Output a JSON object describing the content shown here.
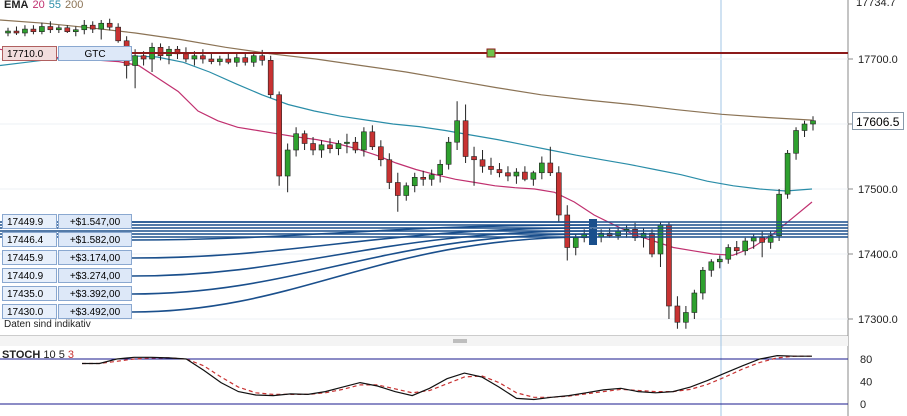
{
  "ema_legend": {
    "label": "EMA",
    "p1": "20",
    "p2": "55",
    "p3": "200",
    "c1": "#c0306f",
    "c2": "#2a8da8",
    "c3": "#8b7355"
  },
  "axis": {
    "price_ticks": [
      {
        "v": 17700,
        "label": "17700.0"
      },
      {
        "v": 17600,
        "label": "17600.0"
      },
      {
        "v": 17500,
        "label": "17500.0"
      },
      {
        "v": 17400,
        "label": "17400.0"
      },
      {
        "v": 17300,
        "label": "17300.0"
      }
    ],
    "top_tick": "17734.7",
    "stoch_ticks": [
      "80",
      "40",
      "0"
    ]
  },
  "current_price": "17606.5",
  "gtc_order": {
    "price": "17710.0",
    "label": "GTC"
  },
  "orders": [
    {
      "price": "17449.9",
      "pnl": "+$1.547,00"
    },
    {
      "price": "17446.4",
      "pnl": "+$1.582,00"
    },
    {
      "price": "17445.9",
      "pnl": "+$3.174,00"
    },
    {
      "price": "17440.9",
      "pnl": "+$3.274,00"
    },
    {
      "price": "17435.0",
      "pnl": "+$3.392,00"
    },
    {
      "price": "17430.0",
      "pnl": "+$3.492,00"
    }
  ],
  "info_text": "Daten sind indikativ",
  "stoch_legend": {
    "label": "STOCH",
    "p1": "10",
    "p2": "5",
    "p3": "3"
  },
  "colors": {
    "up": "#2ea02e",
    "down": "#c83232",
    "order_line": "#1a4f8c",
    "gtc_line": "#8b1a1a",
    "ema20": "#c0306f",
    "ema55": "#2a8da8",
    "ema200": "#8b7355"
  },
  "chart_data": {
    "type": "candlestick",
    "candles": [
      [
        17740,
        17748,
        17735,
        17743
      ],
      [
        17743,
        17750,
        17737,
        17740
      ],
      [
        17740,
        17752,
        17735,
        17746
      ],
      [
        17746,
        17752,
        17738,
        17742
      ],
      [
        17742,
        17756,
        17738,
        17750
      ],
      [
        17750,
        17758,
        17740,
        17745
      ],
      [
        17745,
        17752,
        17740,
        17748
      ],
      [
        17748,
        17752,
        17740,
        17742
      ],
      [
        17742,
        17750,
        17735,
        17745
      ],
      [
        17745,
        17760,
        17738,
        17752
      ],
      [
        17752,
        17758,
        17740,
        17746
      ],
      [
        17746,
        17760,
        17730,
        17755
      ],
      [
        17755,
        17762,
        17744,
        17749
      ],
      [
        17749,
        17755,
        17725,
        17728
      ],
      [
        17728,
        17735,
        17670,
        17690
      ],
      [
        17690,
        17715,
        17655,
        17705
      ],
      [
        17705,
        17712,
        17690,
        17700
      ],
      [
        17700,
        17725,
        17680,
        17718
      ],
      [
        17718,
        17724,
        17698,
        17705
      ],
      [
        17705,
        17720,
        17692,
        17715
      ],
      [
        17715,
        17720,
        17700,
        17708
      ],
      [
        17708,
        17718,
        17695,
        17700
      ],
      [
        17700,
        17712,
        17690,
        17705
      ],
      [
        17705,
        17715,
        17693,
        17700
      ],
      [
        17700,
        17708,
        17692,
        17696
      ],
      [
        17696,
        17705,
        17690,
        17700
      ],
      [
        17700,
        17708,
        17692,
        17695
      ],
      [
        17695,
        17710,
        17688,
        17702
      ],
      [
        17702,
        17710,
        17690,
        17695
      ],
      [
        17695,
        17710,
        17688,
        17705
      ],
      [
        17705,
        17714,
        17690,
        17698
      ],
      [
        17698,
        17705,
        17640,
        17645
      ],
      [
        17645,
        17650,
        17505,
        17520
      ],
      [
        17520,
        17570,
        17495,
        17560
      ],
      [
        17560,
        17595,
        17550,
        17585
      ],
      [
        17585,
        17590,
        17560,
        17570
      ],
      [
        17570,
        17580,
        17552,
        17560
      ],
      [
        17560,
        17575,
        17548,
        17568
      ],
      [
        17568,
        17578,
        17555,
        17562
      ],
      [
        17562,
        17575,
        17552,
        17570
      ],
      [
        17570,
        17585,
        17555,
        17572
      ],
      [
        17572,
        17580,
        17555,
        17560
      ],
      [
        17560,
        17595,
        17550,
        17588
      ],
      [
        17588,
        17598,
        17560,
        17565
      ],
      [
        17565,
        17575,
        17535,
        17545
      ],
      [
        17545,
        17555,
        17500,
        17510
      ],
      [
        17510,
        17525,
        17465,
        17490
      ],
      [
        17490,
        17510,
        17482,
        17505
      ],
      [
        17505,
        17525,
        17495,
        17518
      ],
      [
        17518,
        17528,
        17505,
        17515
      ],
      [
        17515,
        17530,
        17505,
        17522
      ],
      [
        17522,
        17545,
        17510,
        17538
      ],
      [
        17538,
        17580,
        17530,
        17572
      ],
      [
        17572,
        17635,
        17560,
        17605
      ],
      [
        17605,
        17630,
        17540,
        17550
      ],
      [
        17550,
        17565,
        17505,
        17545
      ],
      [
        17545,
        17560,
        17525,
        17535
      ],
      [
        17535,
        17548,
        17522,
        17530
      ],
      [
        17530,
        17540,
        17518,
        17525
      ],
      [
        17525,
        17535,
        17512,
        17520
      ],
      [
        17520,
        17532,
        17508,
        17526
      ],
      [
        17526,
        17535,
        17512,
        17515
      ],
      [
        17515,
        17528,
        17505,
        17525
      ],
      [
        17525,
        17550,
        17515,
        17540
      ],
      [
        17540,
        17565,
        17520,
        17525
      ],
      [
        17525,
        17535,
        17450,
        17460
      ],
      [
        17460,
        17475,
        17390,
        17410
      ],
      [
        17410,
        17430,
        17398,
        17425
      ],
      [
        17425,
        17438,
        17418,
        17430
      ],
      [
        17430,
        17440,
        17420,
        17426
      ],
      [
        17426,
        17438,
        17418,
        17432
      ],
      [
        17432,
        17440,
        17425,
        17428
      ],
      [
        17428,
        17440,
        17422,
        17435
      ],
      [
        17435,
        17445,
        17425,
        17438
      ],
      [
        17438,
        17448,
        17420,
        17425
      ],
      [
        17425,
        17440,
        17410,
        17432
      ],
      [
        17432,
        17438,
        17395,
        17400
      ],
      [
        17400,
        17450,
        17380,
        17445
      ],
      [
        17445,
        17450,
        17300,
        17320
      ],
      [
        17320,
        17335,
        17285,
        17295
      ],
      [
        17295,
        17320,
        17285,
        17310
      ],
      [
        17310,
        17345,
        17300,
        17340
      ],
      [
        17340,
        17380,
        17330,
        17375
      ],
      [
        17375,
        17392,
        17365,
        17388
      ],
      [
        17388,
        17398,
        17378,
        17392
      ],
      [
        17392,
        17415,
        17385,
        17410
      ],
      [
        17410,
        17420,
        17398,
        17405
      ],
      [
        17405,
        17425,
        17398,
        17420
      ],
      [
        17420,
        17430,
        17408,
        17425
      ],
      [
        17425,
        17435,
        17395,
        17418
      ],
      [
        17418,
        17435,
        17408,
        17428
      ],
      [
        17428,
        17500,
        17420,
        17492
      ],
      [
        17492,
        17560,
        17485,
        17555
      ],
      [
        17555,
        17595,
        17545,
        17590
      ],
      [
        17590,
        17605,
        17580,
        17600
      ],
      [
        17600,
        17612,
        17590,
        17605
      ]
    ],
    "ema20": [
      17715,
      17710,
      17705,
      17702,
      17700,
      17698,
      17696,
      17690,
      17670,
      17650,
      17620,
      17605,
      17595,
      17590,
      17585,
      17580,
      17576,
      17570,
      17562,
      17552,
      17540,
      17530,
      17522,
      17515,
      17510,
      17505,
      17502,
      17500,
      17495,
      17480,
      17460,
      17445,
      17430,
      17420,
      17410,
      17405,
      17400,
      17398,
      17410,
      17430,
      17455,
      17480
    ],
    "ema55": [
      17690,
      17695,
      17700,
      17702,
      17704,
      17705,
      17703,
      17695,
      17680,
      17662,
      17645,
      17630,
      17620,
      17612,
      17606,
      17600,
      17596,
      17590,
      17583,
      17576,
      17568,
      17560,
      17552,
      17545,
      17538,
      17530,
      17522,
      17512,
      17505,
      17500,
      17497,
      17500
    ],
    "ema200": [
      17760,
      17755,
      17748,
      17740,
      17730,
      17718,
      17708,
      17700,
      17690,
      17680,
      17668,
      17656,
      17645,
      17637,
      17630,
      17622,
      17615,
      17610,
      17606
    ],
    "stoch_k": [
      72,
      72,
      80,
      83,
      83,
      82,
      80,
      60,
      38,
      22,
      16,
      15,
      18,
      17,
      22,
      30,
      38,
      32,
      22,
      15,
      28,
      45,
      55,
      48,
      30,
      10,
      8,
      12,
      15,
      20,
      25,
      28,
      22,
      20,
      22,
      30,
      42,
      55,
      68,
      80,
      86,
      85,
      85
    ],
    "stoch_d": [
      72,
      72,
      76,
      80,
      82,
      82,
      80,
      68,
      48,
      30,
      20,
      17,
      17,
      17,
      20,
      26,
      34,
      34,
      27,
      20,
      24,
      36,
      48,
      50,
      38,
      20,
      12,
      12,
      14,
      18,
      22,
      26,
      24,
      22,
      22,
      26,
      35,
      48,
      62,
      74,
      82,
      85,
      85
    ]
  }
}
